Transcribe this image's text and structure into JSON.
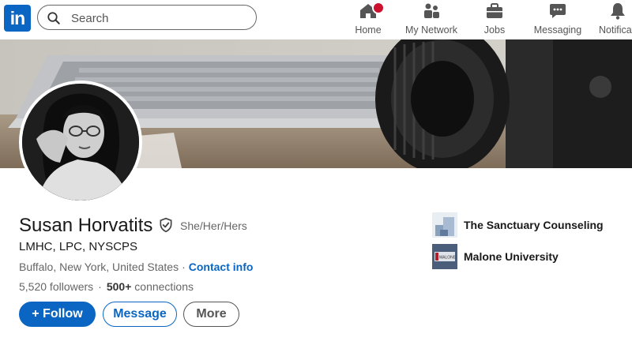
{
  "nav": {
    "logo_text": "in",
    "search": {
      "placeholder": "Search",
      "value": ""
    },
    "items": [
      {
        "label": "Home",
        "icon": "home-icon",
        "has_badge": true
      },
      {
        "label": "My Network",
        "icon": "network-icon"
      },
      {
        "label": "Jobs",
        "icon": "briefcase-icon"
      },
      {
        "label": "Messaging",
        "icon": "messaging-icon"
      },
      {
        "label": "Notificati",
        "icon": "bell-icon"
      }
    ]
  },
  "profile": {
    "name": "Susan Horvatits",
    "pronouns": "She/Her/Hers",
    "headline": "LMHC, LPC, NYSCPS",
    "location": "Buffalo, New York, United States",
    "separator": "·",
    "contact_info": "Contact info",
    "followers": "5,520 followers",
    "connections_count": "500+",
    "connections_label": "connections",
    "buttons": {
      "follow": "+ Follow",
      "message": "Message",
      "more": "More"
    },
    "organizations": [
      {
        "name": "The Sanctuary Counseling",
        "logo": "sanctuary-logo"
      },
      {
        "name": "Malone University",
        "logo": "malone-logo",
        "logo_text": "MALONE"
      }
    ]
  },
  "colors": {
    "brand": "#0a66c2",
    "badge": "#cb112d",
    "page_bg": "#f4f2ee"
  }
}
